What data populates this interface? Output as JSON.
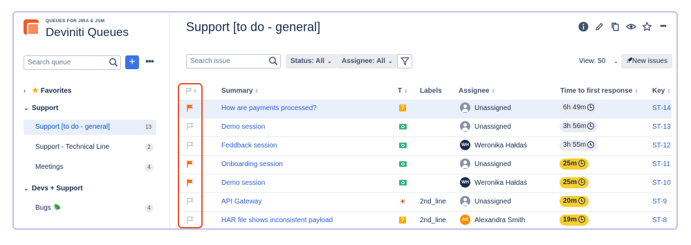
{
  "sidebar": {
    "app_subtitle": "QUEUES FOR JIRA & JSM",
    "app_title": "Deviniti Queues",
    "search_placeholder": "Search queue",
    "add_label": "+",
    "more_label": "•••",
    "items": [
      {
        "type": "group",
        "label": "Favorites",
        "chevron": "›"
      },
      {
        "type": "group",
        "label": "Support",
        "chevron": "⌄"
      },
      {
        "type": "item",
        "label": "Support [to do - general]",
        "count": "13",
        "active": true
      },
      {
        "type": "item",
        "label": "Support - Technical Line",
        "count": "2"
      },
      {
        "type": "item",
        "label": "Meetings",
        "count": "4"
      },
      {
        "type": "group",
        "label": "Devs + Support",
        "chevron": "⌄"
      },
      {
        "type": "item",
        "label": "Bugs 🪲",
        "count": "4"
      }
    ]
  },
  "header": {
    "title": "Support [to do - general]",
    "icons": [
      "info-icon",
      "edit-icon",
      "copy-icon",
      "watch-icon",
      "star-icon",
      "more-icon"
    ]
  },
  "toolbar": {
    "search_placeholder": "Search issue",
    "status_label": "Status: All",
    "assignee_label": "Assignee: All",
    "view_label": "View: 50",
    "new_issues_label": "New issues"
  },
  "table": {
    "headers": {
      "type": "T",
      "summary": "Summary",
      "labels": "Labels",
      "assignee": "Assignee",
      "ttfr": "Time to first response",
      "key": "Key"
    },
    "rows": [
      {
        "flagged": true,
        "summary": "How are payments processed?",
        "type": "question",
        "labels": "",
        "assignee": "Unassigned",
        "avatar": "un",
        "ttfr": "6h 49m",
        "ttfr_style": "grey",
        "key": "ST-14",
        "highlight": true
      },
      {
        "flagged": false,
        "summary": "Demo session",
        "type": "service",
        "labels": "",
        "assignee": "Unassigned",
        "avatar": "un",
        "ttfr": "3h 56m",
        "ttfr_style": "grey",
        "key": "ST-13"
      },
      {
        "flagged": false,
        "summary": "Feddback session",
        "type": "service",
        "labels": "",
        "assignee": "Weronika Hałdaś",
        "avatar": "wh",
        "initials": "WH",
        "ttfr": "3h 55m",
        "ttfr_style": "grey",
        "key": "ST-12"
      },
      {
        "flagged": true,
        "summary": "Onboarding session",
        "type": "service",
        "labels": "",
        "assignee": "Unassigned",
        "avatar": "un",
        "ttfr": "25m",
        "ttfr_style": "yellow",
        "key": "ST-11"
      },
      {
        "flagged": true,
        "summary": "Demo session",
        "type": "service",
        "labels": "",
        "assignee": "Weronika Hałdaś",
        "avatar": "wh",
        "initials": "WH",
        "ttfr": "25m",
        "ttfr_style": "yellow",
        "key": "ST-10"
      },
      {
        "flagged": false,
        "summary": "API Gateway",
        "type": "bug",
        "labels": "2nd_line",
        "assignee": "Unassigned",
        "avatar": "un",
        "ttfr": "20m",
        "ttfr_style": "yellow",
        "key": "ST-9"
      },
      {
        "flagged": false,
        "summary": "HAR file shows inconsistent payload",
        "type": "question",
        "labels": "2nd_line",
        "assignee": "Alexandra Smith",
        "avatar": "as",
        "initials": "AS",
        "ttfr": "19m",
        "ttfr_style": "yellow",
        "key": "ST-8"
      }
    ]
  },
  "colors": {
    "accent": "#3b73e8",
    "flag_on": "#f0701a",
    "flag_off": "#b3bac5",
    "sla_warning": "#f8cd2e",
    "highlight_box": "#e8542e"
  }
}
